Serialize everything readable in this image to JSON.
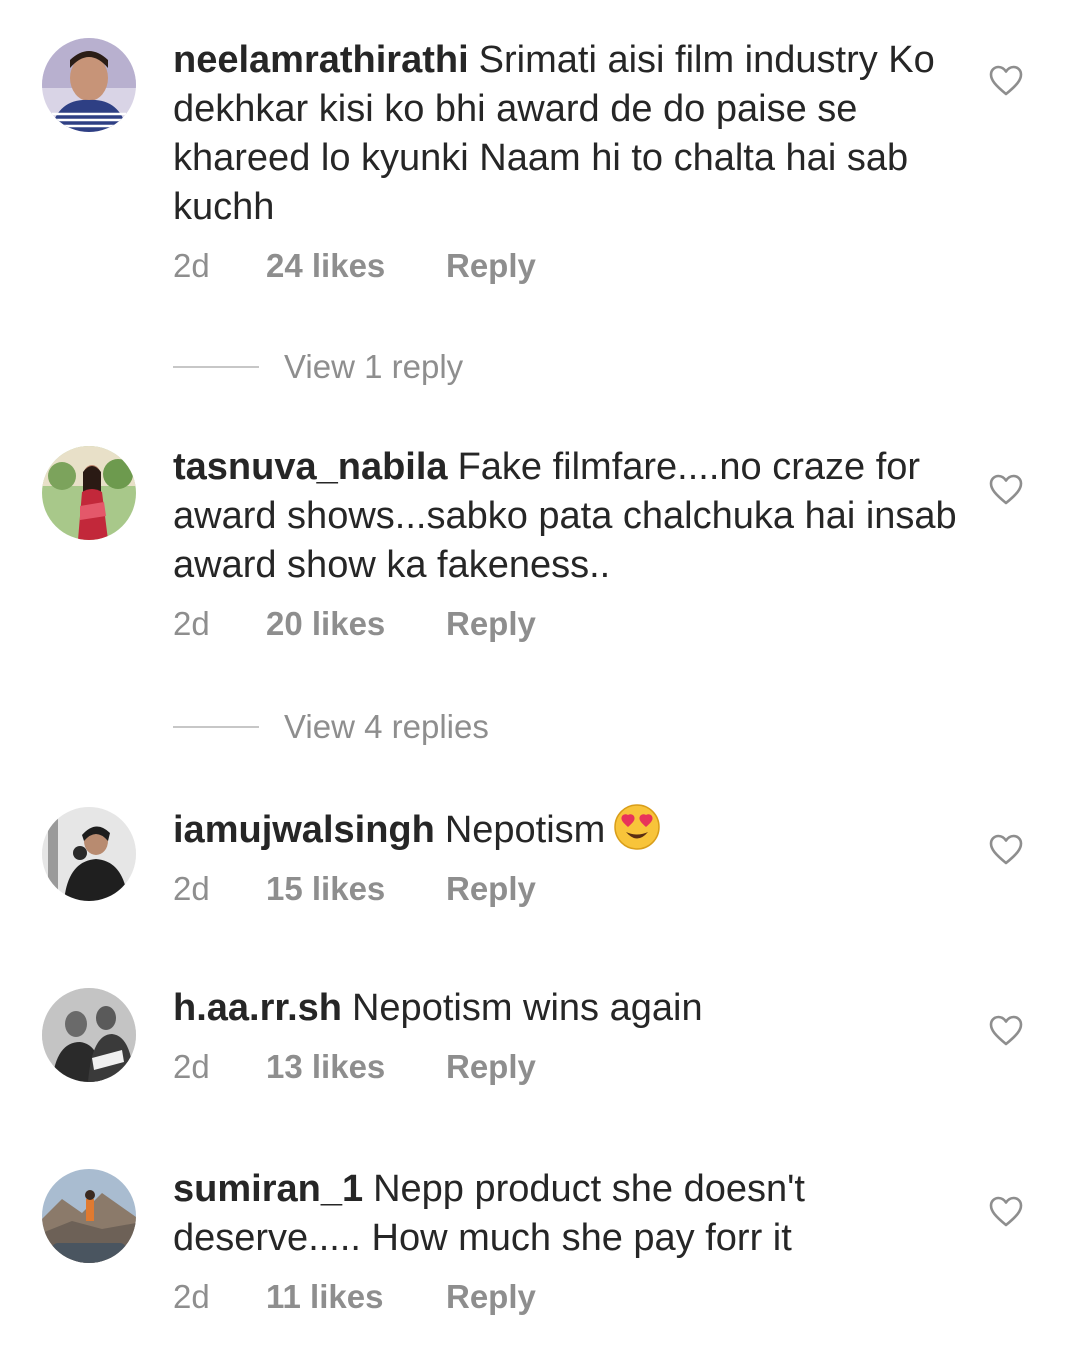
{
  "comments": [
    {
      "username": "neelamrathirathi",
      "text": "Srimati aisi film industry Ko dekhkar kisi ko bhi award de do paise se khareed lo kyunki Naam hi to chalta hai sab kuchh",
      "time": "2d",
      "likes": "24 likes",
      "reply_label": "Reply",
      "view_replies": "View 1 reply",
      "icon": "heart-icon"
    },
    {
      "username": "tasnuva_nabila",
      "text": "Fake filmfare....no craze for award shows...sabko pata chalchuka hai insab award show ka fakeness..",
      "time": "2d",
      "likes": "20 likes",
      "reply_label": "Reply",
      "view_replies": "View 4 replies",
      "icon": "heart-icon"
    },
    {
      "username": "iamujwalsingh",
      "text": "Nepotism",
      "emoji": "smiling-face-with-heart-eyes",
      "time": "2d",
      "likes": "15 likes",
      "reply_label": "Reply",
      "icon": "heart-icon"
    },
    {
      "username": "h.aa.rr.sh",
      "text": "Nepotism wins again",
      "time": "2d",
      "likes": "13 likes",
      "reply_label": "Reply",
      "icon": "heart-icon"
    },
    {
      "username": "sumiran_1",
      "text": "Nepp product she doesn't deserve..... How much she pay forr it",
      "time": "2d",
      "likes": "11 likes",
      "reply_label": "Reply",
      "icon": "heart-icon"
    }
  ],
  "colors": {
    "text": "#262626",
    "meta": "#8e8e8e",
    "divider": "#c7c7c7",
    "heart_outline": "#8e8e8e"
  }
}
